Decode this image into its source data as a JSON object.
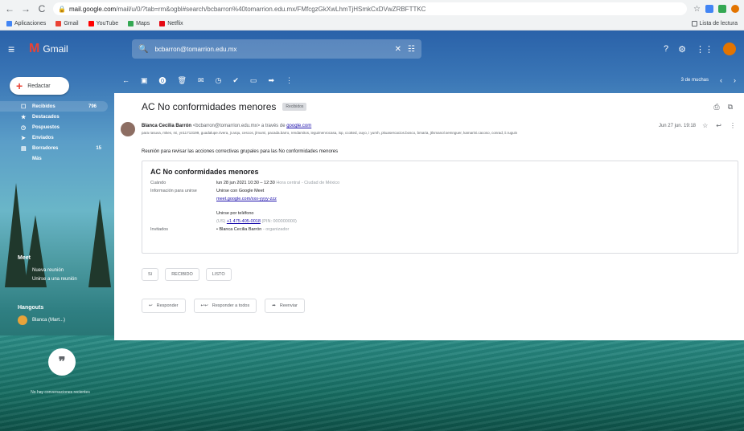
{
  "browser": {
    "url_host": "mail.google.com",
    "url_rest": "/mail/u/0/?tab=rm&ogbl#search/bcbarron%40tomarrion.edu.mx/FMfcgzGkXwLhmTjHSmkCxDVwZRBFTTKC",
    "bookmarks": [
      {
        "label": "Aplicaciones",
        "color": "#4285f4"
      },
      {
        "label": "Gmail",
        "color": "#ea4335"
      },
      {
        "label": "YouTube",
        "color": "#ff0000"
      },
      {
        "label": "Maps",
        "color": "#34a853"
      },
      {
        "label": "Netflix",
        "color": "#e50914"
      }
    ],
    "reading_list": "Lista de lectura"
  },
  "gmail": {
    "logo_text": "Gmail",
    "search_value": "bcbarron@tomarrion.edu.mx",
    "compose_label": "Redactar",
    "pager": "3 de muchas",
    "sidebar": [
      {
        "icon": "☐",
        "label": "Recibidos",
        "count": "796",
        "active": true
      },
      {
        "icon": "★",
        "label": "Destacados",
        "count": ""
      },
      {
        "icon": "◷",
        "label": "Pospuestos",
        "count": ""
      },
      {
        "icon": "➤",
        "label": "Enviados",
        "count": ""
      },
      {
        "icon": "▤",
        "label": "Borradores",
        "count": "15"
      },
      {
        "icon": "",
        "label": "Más",
        "count": ""
      }
    ],
    "meet": {
      "header": "Meet",
      "items": [
        "Nueva reunión",
        "Unirse a una reunión"
      ]
    },
    "hangouts": {
      "header": "Hangouts",
      "user": "Blanca (Mart...)"
    },
    "no_conversations": "No hay conversaciones recientes"
  },
  "mail": {
    "subject": "AC No conformidades menores",
    "label": "Recibidos",
    "sender_name": "Blanca Cecilia Barrón",
    "sender_email": "<bcbarron@tomarrion.edu.mx>",
    "via": "a través de",
    "via_domain": "google.com",
    "recipients": "para rasuva, mkes, mi, yn11713199, guadalupe.rivera, jr.arqu, cescos, jlmumi, pacada.barro, rendamitos, ieguimenrocasa, isp, ccotted, ouyo, i yumh, pkuasercacios.bosco, bmaria, jtlsmanol.semnguer, kamarini.cacoso, conrad, ii.ruguin",
    "date": "Jun 27 jun. 19:18",
    "intro": "Reunión para revisar las acciones correctivas grupales para las No conformidades menores",
    "invite": {
      "title": "AC No conformidades menores",
      "when_label": "Cuándo",
      "when_value": "lun 28 jun 2021 10:30 – 12:30",
      "when_tz": "Hora central - Ciudad de México",
      "join_label": "Información para unirse",
      "join_line": "Unirse con Google Meet",
      "join_link": "meet.google.com/xxx-yyyy-zzz",
      "phone_line": "Unirse por teléfono",
      "phone_prefix": "(US)",
      "phone_link": "+1 475-405-0018",
      "phone_pin": "(PIN: 000000000)",
      "guests_label": "Invitados",
      "guests_value": "• Blanca Cecilia Barrón",
      "guests_role": "- organizador"
    },
    "rsvp": [
      "Sí",
      "RECIBIDO",
      "LISTO"
    ],
    "actions": [
      "Responder",
      "Responder a todos",
      "Reenviar"
    ]
  }
}
